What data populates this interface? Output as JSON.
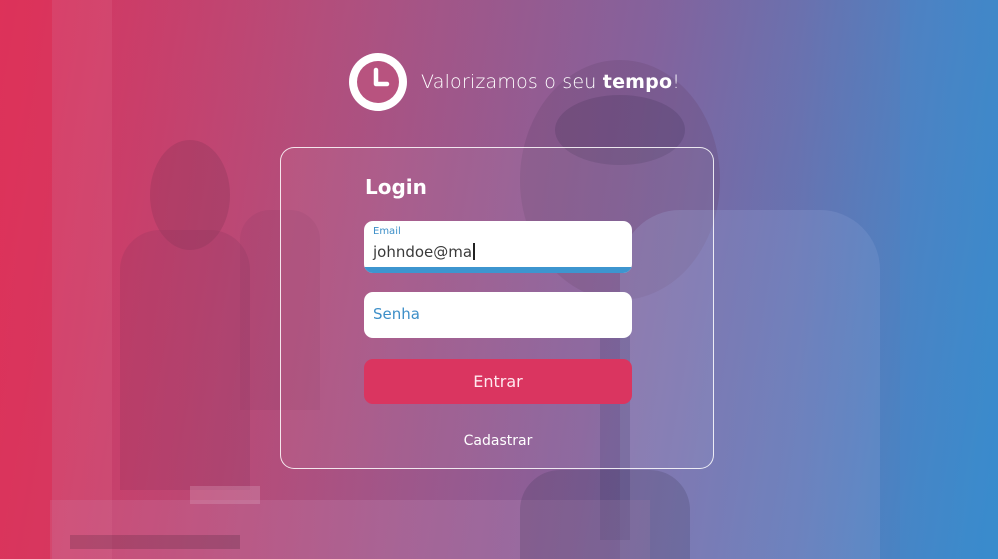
{
  "brand": {
    "tagline_prefix": "Valorizamos o seu ",
    "tagline_bold": "tempo",
    "tagline_suffix": "!",
    "logo_icon": "clock-icon"
  },
  "login": {
    "title": "Login",
    "email_label": "Email",
    "email_value": "johndoe@ma",
    "password_placeholder": "Senha",
    "submit_label": "Entrar",
    "register_link": "Cadastrar"
  },
  "colors": {
    "accent_pink": "#da3560",
    "accent_blue": "#3d95cf"
  }
}
